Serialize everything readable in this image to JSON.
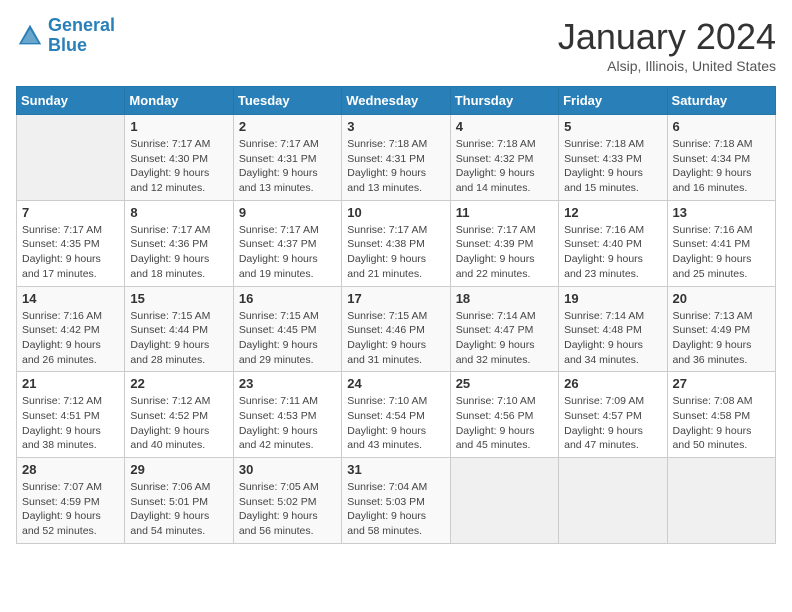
{
  "header": {
    "logo_line1": "General",
    "logo_line2": "Blue",
    "title": "January 2024",
    "subtitle": "Alsip, Illinois, United States"
  },
  "weekdays": [
    "Sunday",
    "Monday",
    "Tuesday",
    "Wednesday",
    "Thursday",
    "Friday",
    "Saturday"
  ],
  "weeks": [
    [
      {
        "day": "",
        "info": ""
      },
      {
        "day": "1",
        "info": "Sunrise: 7:17 AM\nSunset: 4:30 PM\nDaylight: 9 hours\nand 12 minutes."
      },
      {
        "day": "2",
        "info": "Sunrise: 7:17 AM\nSunset: 4:31 PM\nDaylight: 9 hours\nand 13 minutes."
      },
      {
        "day": "3",
        "info": "Sunrise: 7:18 AM\nSunset: 4:31 PM\nDaylight: 9 hours\nand 13 minutes."
      },
      {
        "day": "4",
        "info": "Sunrise: 7:18 AM\nSunset: 4:32 PM\nDaylight: 9 hours\nand 14 minutes."
      },
      {
        "day": "5",
        "info": "Sunrise: 7:18 AM\nSunset: 4:33 PM\nDaylight: 9 hours\nand 15 minutes."
      },
      {
        "day": "6",
        "info": "Sunrise: 7:18 AM\nSunset: 4:34 PM\nDaylight: 9 hours\nand 16 minutes."
      }
    ],
    [
      {
        "day": "7",
        "info": "Sunrise: 7:17 AM\nSunset: 4:35 PM\nDaylight: 9 hours\nand 17 minutes."
      },
      {
        "day": "8",
        "info": "Sunrise: 7:17 AM\nSunset: 4:36 PM\nDaylight: 9 hours\nand 18 minutes."
      },
      {
        "day": "9",
        "info": "Sunrise: 7:17 AM\nSunset: 4:37 PM\nDaylight: 9 hours\nand 19 minutes."
      },
      {
        "day": "10",
        "info": "Sunrise: 7:17 AM\nSunset: 4:38 PM\nDaylight: 9 hours\nand 21 minutes."
      },
      {
        "day": "11",
        "info": "Sunrise: 7:17 AM\nSunset: 4:39 PM\nDaylight: 9 hours\nand 22 minutes."
      },
      {
        "day": "12",
        "info": "Sunrise: 7:16 AM\nSunset: 4:40 PM\nDaylight: 9 hours\nand 23 minutes."
      },
      {
        "day": "13",
        "info": "Sunrise: 7:16 AM\nSunset: 4:41 PM\nDaylight: 9 hours\nand 25 minutes."
      }
    ],
    [
      {
        "day": "14",
        "info": "Sunrise: 7:16 AM\nSunset: 4:42 PM\nDaylight: 9 hours\nand 26 minutes."
      },
      {
        "day": "15",
        "info": "Sunrise: 7:15 AM\nSunset: 4:44 PM\nDaylight: 9 hours\nand 28 minutes."
      },
      {
        "day": "16",
        "info": "Sunrise: 7:15 AM\nSunset: 4:45 PM\nDaylight: 9 hours\nand 29 minutes."
      },
      {
        "day": "17",
        "info": "Sunrise: 7:15 AM\nSunset: 4:46 PM\nDaylight: 9 hours\nand 31 minutes."
      },
      {
        "day": "18",
        "info": "Sunrise: 7:14 AM\nSunset: 4:47 PM\nDaylight: 9 hours\nand 32 minutes."
      },
      {
        "day": "19",
        "info": "Sunrise: 7:14 AM\nSunset: 4:48 PM\nDaylight: 9 hours\nand 34 minutes."
      },
      {
        "day": "20",
        "info": "Sunrise: 7:13 AM\nSunset: 4:49 PM\nDaylight: 9 hours\nand 36 minutes."
      }
    ],
    [
      {
        "day": "21",
        "info": "Sunrise: 7:12 AM\nSunset: 4:51 PM\nDaylight: 9 hours\nand 38 minutes."
      },
      {
        "day": "22",
        "info": "Sunrise: 7:12 AM\nSunset: 4:52 PM\nDaylight: 9 hours\nand 40 minutes."
      },
      {
        "day": "23",
        "info": "Sunrise: 7:11 AM\nSunset: 4:53 PM\nDaylight: 9 hours\nand 42 minutes."
      },
      {
        "day": "24",
        "info": "Sunrise: 7:10 AM\nSunset: 4:54 PM\nDaylight: 9 hours\nand 43 minutes."
      },
      {
        "day": "25",
        "info": "Sunrise: 7:10 AM\nSunset: 4:56 PM\nDaylight: 9 hours\nand 45 minutes."
      },
      {
        "day": "26",
        "info": "Sunrise: 7:09 AM\nSunset: 4:57 PM\nDaylight: 9 hours\nand 47 minutes."
      },
      {
        "day": "27",
        "info": "Sunrise: 7:08 AM\nSunset: 4:58 PM\nDaylight: 9 hours\nand 50 minutes."
      }
    ],
    [
      {
        "day": "28",
        "info": "Sunrise: 7:07 AM\nSunset: 4:59 PM\nDaylight: 9 hours\nand 52 minutes."
      },
      {
        "day": "29",
        "info": "Sunrise: 7:06 AM\nSunset: 5:01 PM\nDaylight: 9 hours\nand 54 minutes."
      },
      {
        "day": "30",
        "info": "Sunrise: 7:05 AM\nSunset: 5:02 PM\nDaylight: 9 hours\nand 56 minutes."
      },
      {
        "day": "31",
        "info": "Sunrise: 7:04 AM\nSunset: 5:03 PM\nDaylight: 9 hours\nand 58 minutes."
      },
      {
        "day": "",
        "info": ""
      },
      {
        "day": "",
        "info": ""
      },
      {
        "day": "",
        "info": ""
      }
    ]
  ]
}
